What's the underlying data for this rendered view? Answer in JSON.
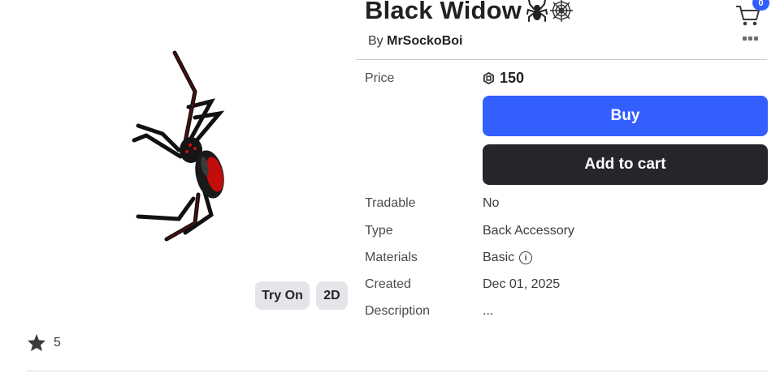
{
  "item": {
    "name": "Black Widow",
    "creator_prefix": "By",
    "creator": "MrSockoBoi",
    "price_label": "Price",
    "price": "150"
  },
  "header": {
    "cart_count": "0",
    "cart_icon": "cart-icon",
    "more_icon": "more-options-icon"
  },
  "actions": {
    "buy": "Buy",
    "add_to_cart": "Add to cart",
    "try_on": "Try On",
    "view_2d": "2D"
  },
  "details": [
    {
      "label": "Tradable",
      "value": "No"
    },
    {
      "label": "Type",
      "value": "Back Accessory"
    },
    {
      "label": "Materials",
      "value": "Basic"
    },
    {
      "label": "Created",
      "value": "Dec 01, 2025"
    },
    {
      "label": "Description",
      "value": "..."
    }
  ],
  "favorites": {
    "count": "5",
    "icon": "star-icon"
  },
  "colors": {
    "buy": "#335fff",
    "cart_button": "#24262b",
    "badge": "#335fff"
  }
}
